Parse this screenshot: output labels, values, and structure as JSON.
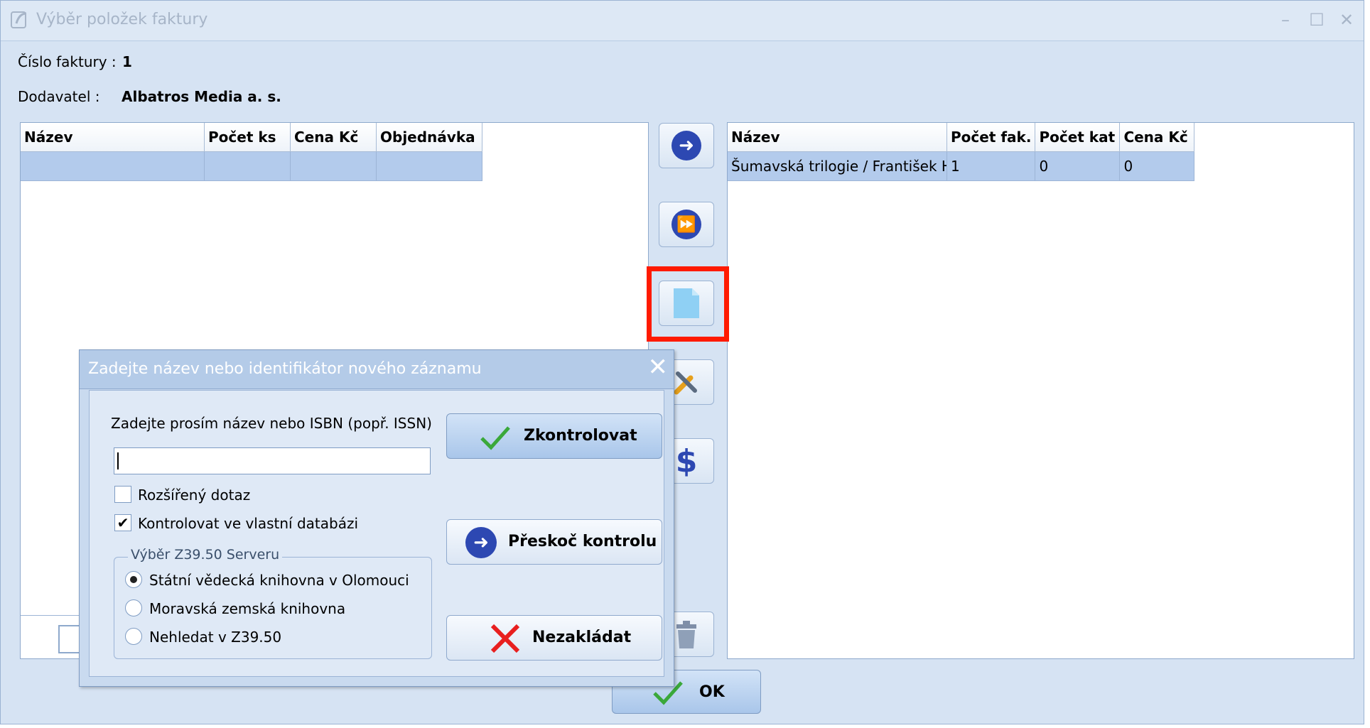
{
  "window": {
    "title": "Výběr položek faktury",
    "minimize": "–",
    "maximize": "☐",
    "close": "✕"
  },
  "header": {
    "invoice_label": "Číslo faktury :",
    "invoice_value": "1",
    "supplier_label": "Dodavatel :",
    "supplier_value": "Albatros Media a. s."
  },
  "left_grid": {
    "columns": [
      "Název",
      "Počet ks",
      "Cena Kč",
      "Objednávka"
    ],
    "rows": [
      [
        "",
        "",
        "",
        ""
      ]
    ]
  },
  "right_grid": {
    "columns": [
      "Název",
      "Počet fak.",
      "Počet kat",
      "Cena Kč"
    ],
    "rows": [
      [
        "Šumavská trilogie / František Hrubín",
        "1",
        "0",
        "0"
      ]
    ]
  },
  "side_buttons": {
    "move_one": "arrow-right-icon",
    "move_all": "fast-forward-icon",
    "new_record": "new-document-icon",
    "tools": "wrench-icon",
    "price": "dollar-icon",
    "delete": "trash-icon"
  },
  "dialog": {
    "title": "Zadejte název nebo identifikátor nového záznamu",
    "close": "✕",
    "prompt": "Zadejte prosím název nebo ISBN (popř. ISSN)",
    "input_value": "",
    "extended_query_label": "Rozšířený dotaz",
    "extended_query_checked": false,
    "check_own_db_label": "Kontrolovat ve vlastní databázi",
    "check_own_db_checked": true,
    "server_group_title": "Výběr Z39.50 Serveru",
    "servers": [
      {
        "label": "Státní vědecká knihovna v Olomouci",
        "selected": true
      },
      {
        "label": "Moravská zemská knihovna",
        "selected": false
      },
      {
        "label": "Nehledat v Z39.50",
        "selected": false
      }
    ],
    "check_button": "Zkontrolovat",
    "skip_button": "Přeskoč kontrolu",
    "cancel_button": "Nezakládat"
  },
  "ok_button": "OK",
  "colors": {
    "accent": "#2d48b2",
    "highlight": "#ff1a00",
    "check_green": "#3aa83a",
    "cancel_red": "#e81f1f"
  }
}
